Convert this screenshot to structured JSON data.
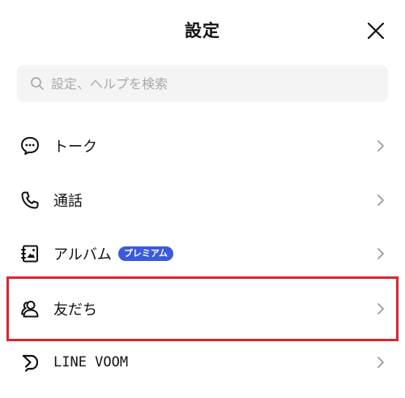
{
  "header": {
    "title": "設定"
  },
  "search": {
    "placeholder": "設定、ヘルプを検索"
  },
  "menu": {
    "items": [
      {
        "label": "トーク",
        "icon": "chat-bubble-icon"
      },
      {
        "label": "通話",
        "icon": "phone-icon"
      },
      {
        "label": "アルバム",
        "icon": "album-icon",
        "badge": "プレミアム"
      },
      {
        "label": "友だち",
        "icon": "friends-icon"
      },
      {
        "label": "LINE VOOM",
        "icon": "voom-icon"
      }
    ]
  },
  "colors": {
    "highlight": "#d9262f",
    "badge": "#3b5bdb",
    "search_bg": "#f4f4f4",
    "chevron": "#9a9a9a"
  }
}
